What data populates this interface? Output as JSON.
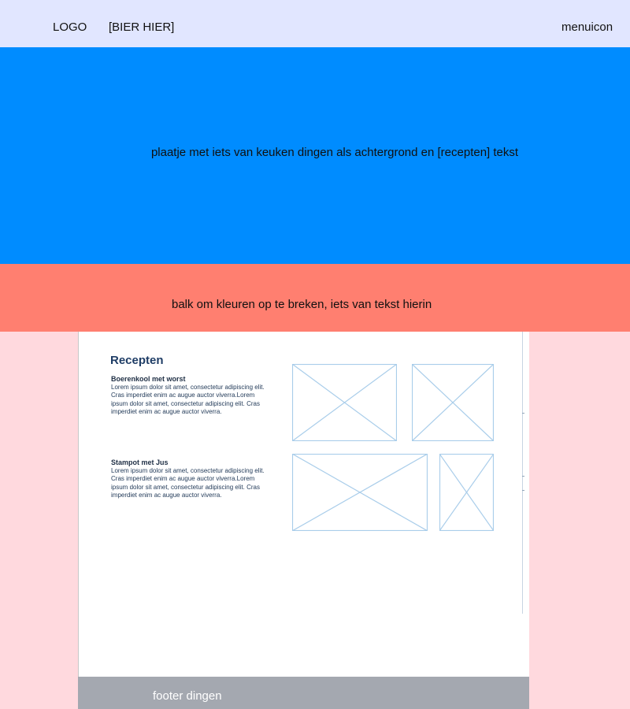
{
  "header": {
    "logo": "LOGO",
    "beer": "[BIER HIER]",
    "menu": "menuicon"
  },
  "hero": {
    "text": "plaatje met iets van keuken dingen als achtergrond en [recepten] tekst"
  },
  "band": {
    "text": "balk om kleuren op te breken, iets van tekst hierin"
  },
  "recipes": {
    "title": "Recepten",
    "items": [
      {
        "title": "Boerenkool met worst",
        "body": "Lorem ipsum dolor sit amet, consectetur adipiscing elit. Cras imperdiet enim ac augue auctor viverra.Lorem ipsum dolor sit amet, consectetur adipiscing elit. Cras imperdiet enim ac augue auctor viverra."
      },
      {
        "title": "Stampot met Jus",
        "body": "Lorem ipsum dolor sit amet, consectetur adipiscing elit. Cras imperdiet enim ac augue auctor viverra.Lorem ipsum dolor sit amet, consectetur adipiscing elit. Cras imperdiet enim ac augue auctor viverra."
      }
    ]
  },
  "footer": {
    "text": "footer dingen"
  },
  "colors": {
    "topbar": "#e1e6ff",
    "hero": "#008cff",
    "band": "#ff7f70",
    "page_bg": "#ffd9de",
    "footer": "#a4a8b0",
    "placeholder_stroke": "#a9cdea"
  }
}
